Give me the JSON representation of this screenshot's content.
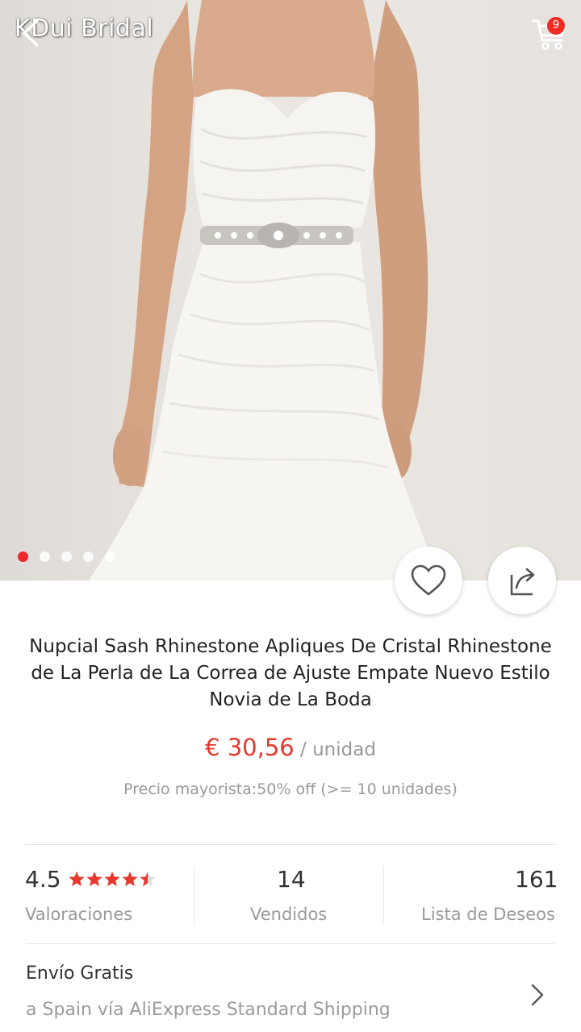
{
  "header": {
    "watermark": "KDui Bridal",
    "cart_count": "9"
  },
  "gallery": {
    "image_description_icon": "bridal-gown-photo",
    "slide_count": 5,
    "active_slide": 1
  },
  "product": {
    "title": "Nupcial Sash Rhinestone Apliques De Cristal Rhinestone de La Perla de La Correa de Ajuste Empate Nuevo Estilo Novia de La Boda",
    "price": "€ 30,56",
    "unit": " / unidad",
    "wholesale": "Precio mayorista:50% off (>= 10 unidades)"
  },
  "stats": {
    "rating": {
      "value": "4.5",
      "label": "Valoraciones",
      "stars": 4.5
    },
    "sold": {
      "value": "14",
      "label": "Vendidos"
    },
    "wishlist": {
      "value": "161",
      "label": "Lista de Deseos"
    }
  },
  "shipping": {
    "title": "Envío Gratis",
    "detail": "a Spain vía AliExpress Standard Shipping"
  },
  "colors": {
    "accent": "#f0282d",
    "price": "#e8382d",
    "muted": "#9a9a9a"
  }
}
